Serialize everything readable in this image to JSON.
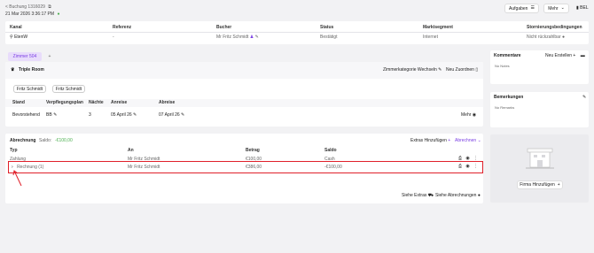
{
  "header": {
    "back_label": "< Buchung 1316029",
    "date_line": "21 Mar 2026 3:36:17 PM",
    "tasks_button": "Aufgaben",
    "more_button": "Mehr",
    "status_short": "BEL"
  },
  "booking_table": {
    "columns": [
      "Kanal",
      "Referenz",
      "Bucher",
      "Status",
      "Marktsegment",
      "Stornierungsbedingungen"
    ],
    "row": [
      "EtenW",
      "-",
      "Mr Fritz Schmidt",
      "Bestätigt",
      "Internet",
      "Nicht rückzahlbar"
    ]
  },
  "room_tabs": {
    "active": "Zimmer 504",
    "add": "+"
  },
  "room": {
    "name": "Triple Room",
    "change_category": "Zimmerkategorie Wechseln",
    "new_assign": "Neu Zuordnen",
    "guests": [
      "Fritz Schmidt",
      "Fritz Schmidt"
    ],
    "columns": [
      "Stand",
      "Verpflegungsplan",
      "Nächte",
      "Anreise",
      "Abreise"
    ],
    "values": [
      "Bevorstehend",
      "BB",
      "3",
      "05 April 26",
      "07 April 26"
    ],
    "more": "Mehr"
  },
  "billing": {
    "title": "Abrechnung",
    "saldo_label": "Saldo:",
    "saldo_value": "-€100,00",
    "add_extras": "Extras Hinzufügen",
    "settle": "Abrechnen",
    "columns": [
      "Typ",
      "An",
      "Betrag",
      "Saldo"
    ],
    "rows": [
      {
        "type": "Zahlung",
        "to": "Mr Fritz Schmidt",
        "amount": "€100,00",
        "saldo": "Cash"
      },
      {
        "type": "Rechnung (1)",
        "to": "Mr Fritz Schmidt",
        "amount": "€386,00",
        "saldo": "-€100,00"
      }
    ],
    "see_extras": "Siehe Extras",
    "see_bills": "Siehe Abrechnungen"
  },
  "comments": {
    "title": "Kommentare",
    "new": "Neu Erstellen",
    "empty": "No Notes"
  },
  "remarks": {
    "title": "Bemerkungen",
    "empty": "No Remarks"
  },
  "company": {
    "add_button": "Firma Hinzufügen"
  },
  "colors": {
    "accent": "#7b3fe4",
    "saldo_green": "#4caf50",
    "highlight_red": "#e0202a",
    "tab_bg": "#e8dcfb"
  }
}
